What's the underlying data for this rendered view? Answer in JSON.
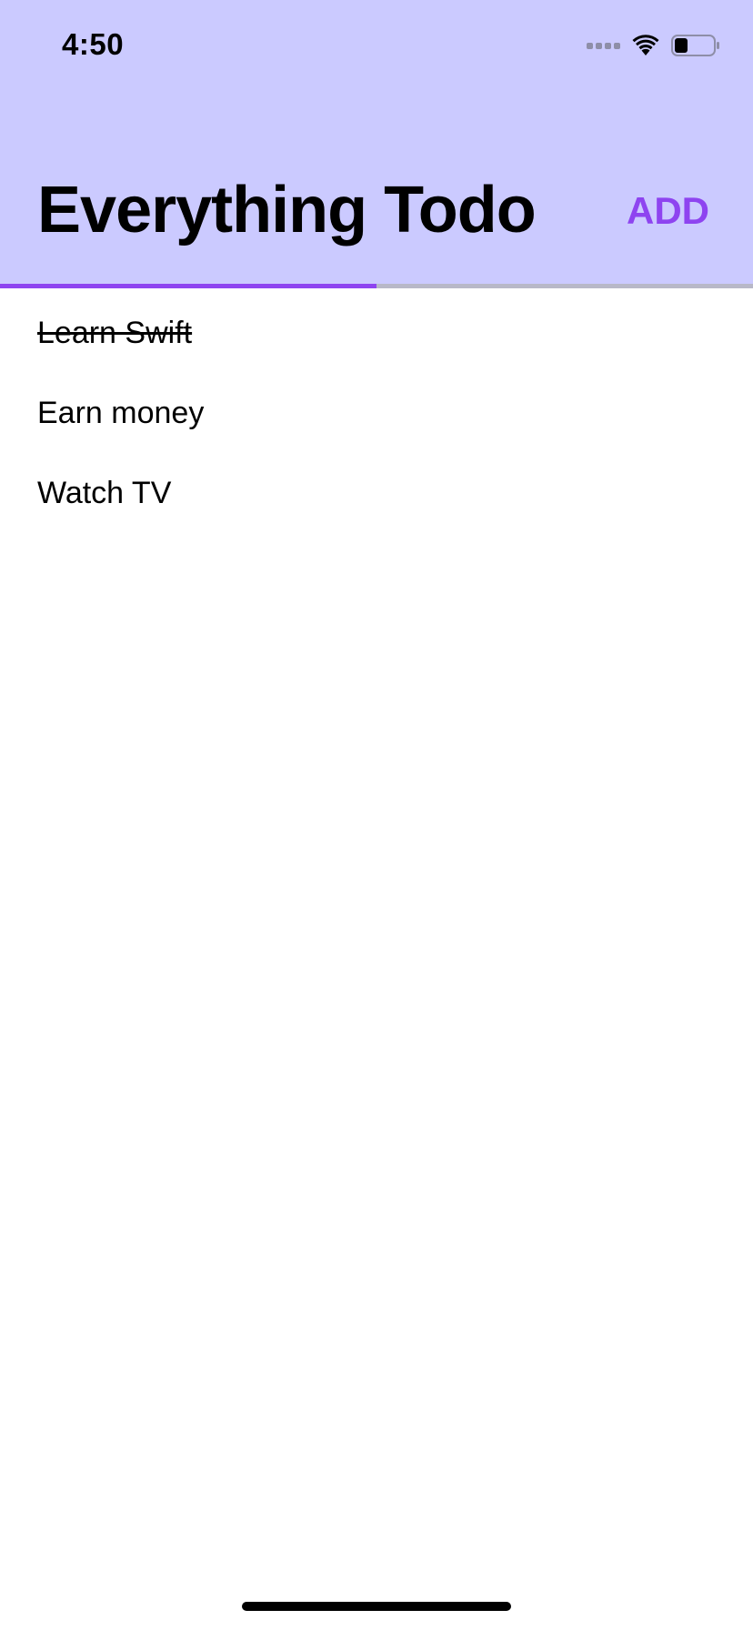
{
  "status_bar": {
    "time": "4:50"
  },
  "header": {
    "title": "Everything Todo",
    "add_label": "ADD"
  },
  "progress": {
    "completed_fraction": 0.5
  },
  "todos": [
    {
      "label": "Learn Swift",
      "done": true
    },
    {
      "label": "Earn money",
      "done": false
    },
    {
      "label": "Watch TV",
      "done": false
    }
  ],
  "colors": {
    "header_background": "#cbcaff",
    "accent": "#8e44f0",
    "track": "#b8b8c8",
    "text": "#000000"
  },
  "icons": {
    "signal": "cellular-signal-icon",
    "wifi": "wifi-icon",
    "battery": "battery-icon"
  }
}
